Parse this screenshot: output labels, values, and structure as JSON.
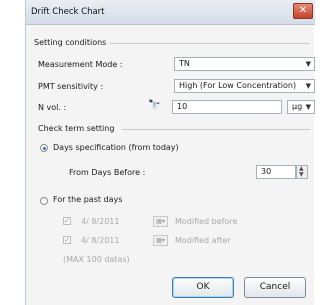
{
  "window": {
    "title": "Drift Check Chart"
  },
  "setting_conditions": {
    "label": "Setting conditions",
    "measurement_mode": {
      "label": "Measurement Mode :",
      "value": "TN"
    },
    "pmt_sensitivity": {
      "label": "PMT sensitivity :",
      "value": "High (For Low Concentration)"
    },
    "n_vol": {
      "label": "N vol. :",
      "value": "10",
      "unit": "μg"
    }
  },
  "check_term": {
    "label": "Check term setting",
    "days_spec": {
      "label": "Days specification (from today)",
      "selected": true
    },
    "from_days_before": {
      "label": "From Days Before :",
      "value": "30"
    },
    "past_days": {
      "label": "For the past days",
      "selected": false
    },
    "modified_before": {
      "date": "4/ 8/2011",
      "label": "Modified before"
    },
    "modified_after": {
      "date": "4/ 8/2011",
      "label": "Modified after"
    },
    "max_note": "(MAX 100 datas)"
  },
  "buttons": {
    "ok": "OK",
    "cancel": "Cancel"
  },
  "icons": {
    "close": "close-icon",
    "search": "binoculars-icon"
  }
}
